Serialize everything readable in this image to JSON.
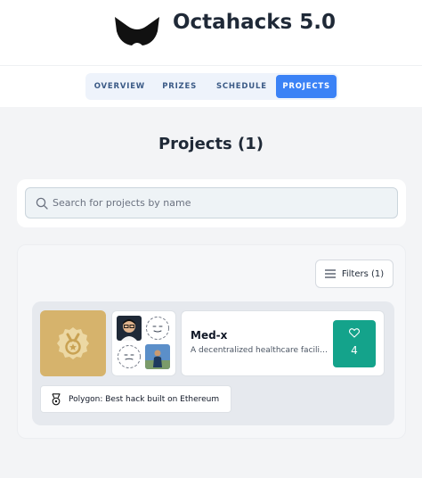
{
  "header": {
    "title": "Octahacks 5.0",
    "logo_icon": "octahacks-logo"
  },
  "nav": {
    "tabs": [
      {
        "label": "OVERVIEW",
        "active": false
      },
      {
        "label": "PRIZES",
        "active": false
      },
      {
        "label": "SCHEDULE",
        "active": false
      },
      {
        "label": "PROJECTS",
        "active": true
      }
    ]
  },
  "main": {
    "title": "Projects (1)",
    "search": {
      "placeholder": "Search for projects by name",
      "value": ""
    },
    "filters": {
      "label": "Filters (1)"
    },
    "projects": [
      {
        "name": "Med-x",
        "description": "A decentralized healthcare facilit...",
        "likes": "4",
        "prize": "Polygon: Best hack built on Ethereum"
      }
    ]
  },
  "colors": {
    "accent": "#3b82f6",
    "like": "#14a38b",
    "prize_tile": "#d6b36c"
  }
}
